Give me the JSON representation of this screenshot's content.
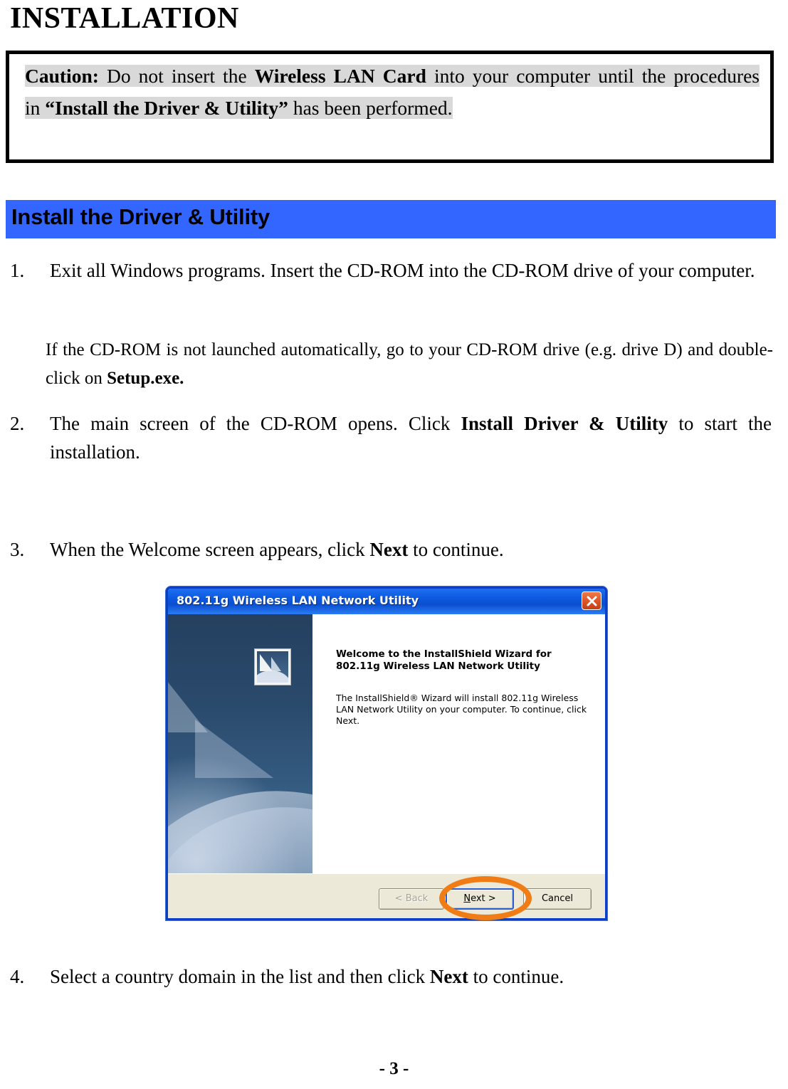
{
  "page": {
    "title": "INSTALLATION",
    "page_number": "- 3 -"
  },
  "caution": {
    "label": "Caution:",
    "text_part1": "Do not insert the",
    "emphasis1": "Wireless LAN Card",
    "text_part2": "into your computer until the procedures in",
    "emphasis2": "“Install the Driver & Utility”",
    "text_part3": "has been performed."
  },
  "section": {
    "banner_label": "Install the Driver & Utility",
    "banner_color": "#3366ff"
  },
  "steps": [
    {
      "number": "1.",
      "text": "Exit all Windows programs. Insert the CD-ROM into the CD-ROM drive of your computer."
    },
    {
      "number": "2.",
      "text_part1": "The main screen of the CD-ROM opens. Click",
      "emphasis": "Install Driver & Utility",
      "text_part2": "to start the installation."
    },
    {
      "number": "3.",
      "text_part1": "When the Welcome screen appears, click",
      "emphasis": "Next",
      "text_part2": "to continue."
    },
    {
      "number": "4.",
      "text_part1": "Select a country domain in the list and then click",
      "emphasis": "Next",
      "text_part2": "to continue."
    }
  ],
  "sub_paragraph": {
    "text_part1": "If the CD-ROM is not launched automatically, go to your CD-ROM drive (e.g. drive D) and double-click on",
    "emphasis": "Setup.exe."
  },
  "dialog": {
    "title": "802.11g Wireless LAN Network Utility",
    "close_icon": "close-icon",
    "welcome_heading": "Welcome to the InstallShield Wizard for 802.11g Wireless LAN Network Utility",
    "welcome_body": "The InstallShield® Wizard will install 802.11g Wireless LAN Network Utility on your computer.  To continue, click Next.",
    "buttons": {
      "back": "< Back",
      "next_prefix": "N",
      "next_suffix": "ext >",
      "cancel": "Cancel"
    },
    "titlebar_color": "#0b57dd",
    "highlight_color": "#f07c16"
  }
}
